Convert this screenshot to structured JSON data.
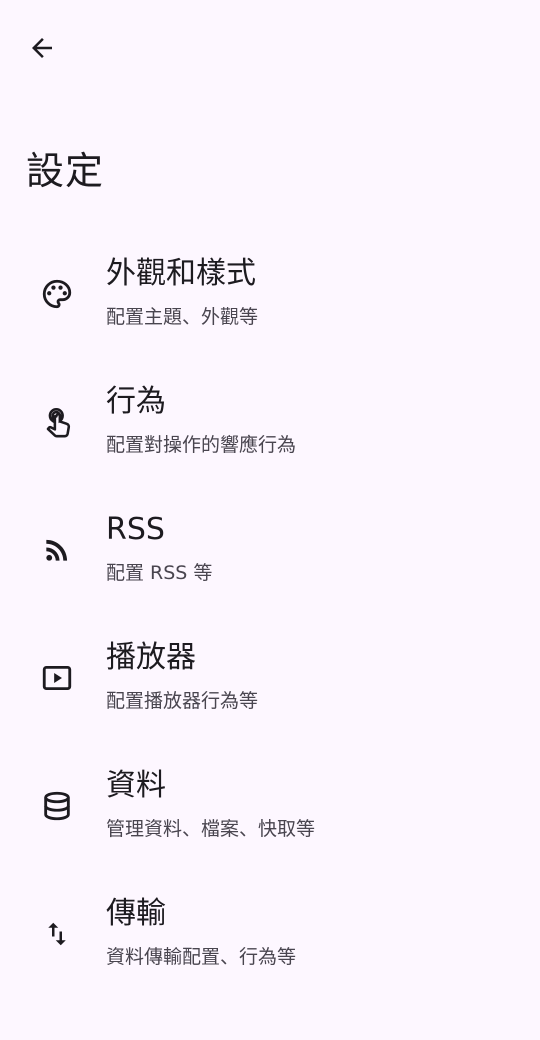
{
  "header": {
    "back_icon": "arrow-back-icon",
    "title": "設定"
  },
  "items": [
    {
      "icon": "palette-icon",
      "title": "外觀和樣式",
      "subtitle": "配置主題、外觀等"
    },
    {
      "icon": "touch-icon",
      "title": "行為",
      "subtitle": "配置對操作的響應行為"
    },
    {
      "icon": "rss-feed-icon",
      "title": "RSS",
      "subtitle": "配置 RSS 等"
    },
    {
      "icon": "play-box-icon",
      "title": "播放器",
      "subtitle": "配置播放器行為等"
    },
    {
      "icon": "database-icon",
      "title": "資料",
      "subtitle": "管理資料、檔案、快取等"
    },
    {
      "icon": "swap-vertical-icon",
      "title": "傳輸",
      "subtitle": "資料傳輸配置、行為等"
    }
  ],
  "colors": {
    "background": "#fdf7ff",
    "text_primary": "#1d1b20",
    "text_secondary": "#49454f"
  }
}
